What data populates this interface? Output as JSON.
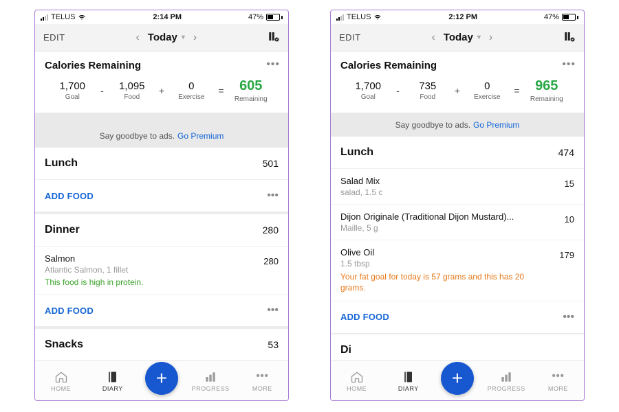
{
  "phones": [
    {
      "status": {
        "carrier": "TELUS",
        "time": "2:14 PM",
        "battery": "47%"
      },
      "nav": {
        "edit": "EDIT",
        "today": "Today"
      },
      "calories_title": "Calories Remaining",
      "calories": {
        "goal": "1,700",
        "food": "1,095",
        "exercise": "0",
        "remaining": "605",
        "lbl_goal": "Goal",
        "lbl_food": "Food",
        "lbl_ex": "Exercise",
        "lbl_rem": "Remaining"
      },
      "ad": {
        "text": "Say goodbye to ads.",
        "link": "Go Premium"
      },
      "sections": [
        {
          "type": "meal",
          "name": "Lunch",
          "cals": "501",
          "foods": [],
          "addfood": "ADD FOOD"
        },
        {
          "type": "gap"
        },
        {
          "type": "meal",
          "name": "Dinner",
          "cals": "280",
          "foods": [
            {
              "title": "Salmon",
              "sub": "Atlantic Salmon, 1 fillet",
              "cals": "280",
              "note_green": "This food is high in protein."
            }
          ],
          "addfood": "ADD FOOD"
        },
        {
          "type": "gap"
        },
        {
          "type": "mealhead",
          "name": "Snacks",
          "cals": "53"
        }
      ],
      "tabs": {
        "home": "HOME",
        "diary": "DIARY",
        "progress": "PROGRESS",
        "more": "MORE"
      }
    },
    {
      "status": {
        "carrier": "TELUS",
        "time": "2:12 PM",
        "battery": "47%"
      },
      "nav": {
        "edit": "EDIT",
        "today": "Today"
      },
      "calories_title": "Calories Remaining",
      "calories": {
        "goal": "1,700",
        "food": "735",
        "exercise": "0",
        "remaining": "965",
        "lbl_goal": "Goal",
        "lbl_food": "Food",
        "lbl_ex": "Exercise",
        "lbl_rem": "Remaining"
      },
      "ad": {
        "text": "Say goodbye to ads.",
        "link": "Go Premium"
      },
      "sections": [
        {
          "type": "meal",
          "name": "Lunch",
          "cals": "474",
          "foods": [
            {
              "title": "Salad Mix",
              "sub": "salad, 1.5 c",
              "cals": "15"
            },
            {
              "title": "Dijon Originale (Traditional Dijon Mustard)...",
              "sub": "Maille, 5 g",
              "cals": "10"
            },
            {
              "title": "Olive Oil",
              "sub": "1.5 tbsp",
              "cals": "179",
              "note_orange": "Your fat goal for today is 57 grams and this has 20 grams."
            }
          ],
          "addfood": "ADD FOOD"
        },
        {
          "type": "gap"
        },
        {
          "type": "mealhead-partial",
          "name": "Di"
        }
      ],
      "tabs": {
        "home": "HOME",
        "diary": "DIARY",
        "progress": "PROGRESS",
        "more": "MORE"
      }
    }
  ]
}
